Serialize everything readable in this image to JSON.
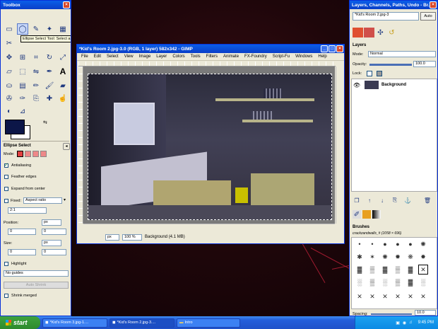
{
  "toolbox": {
    "title": "Toolbox",
    "tooltip": "Ellipse Select Tool: Select an elliptical region",
    "options_title": "Ellipse Select",
    "mode_label": "Mode:",
    "antialiasing": "Antialiasing",
    "feather_edges": "Feather edges",
    "expand_from_center": "Expand from center",
    "fixed_label": "Fixed:",
    "fixed_value": "Aspect ratio",
    "ratio_value": "2:1",
    "position_label": "Position:",
    "pos_x": "0",
    "pos_y": "0",
    "size_label": "Size:",
    "size_w": "0",
    "size_h": "0",
    "unit": "px",
    "highlight": "Highlight",
    "guides": "No guides",
    "auto_shrink": "Auto Shrink",
    "shrink_merged": "Shrink merged"
  },
  "image_window": {
    "title": "*Kid's Room 2.jpg-3.0 (RGB, 1 layer) 582x342 - GIMP",
    "menu": [
      "File",
      "Edit",
      "Select",
      "View",
      "Image",
      "Layer",
      "Colors",
      "Tools",
      "Filters",
      "Animate",
      "FX-Foundry",
      "Script-Fu",
      "Windows",
      "Help"
    ],
    "unit": "px",
    "zoom": "100 %",
    "status": "Background (4.1 MB)"
  },
  "layers_dock": {
    "title": "Layers, Channels, Paths, Undo - Br...",
    "image_select": "*Kid's Room 2.jpg-3",
    "auto_label": "Auto",
    "layers_title": "Layers",
    "mode_label": "Mode:",
    "mode_value": "Normal",
    "opacity_label": "Opacity:",
    "opacity_value": "100.0",
    "lock_label": "Lock:",
    "layer_name": "Background",
    "brushes_title": "Brushes",
    "brush_name": "crackzandwalls_# (1058 × 696)",
    "spacing_label": "Spacing:",
    "spacing_value": "10.0"
  },
  "taskbar": {
    "start": "start",
    "items": [
      "*Kid's Room 3.jpg-1....",
      "*Kid's Room 2.jpg-3....",
      "Intro"
    ],
    "clock": "9:45 PM"
  }
}
